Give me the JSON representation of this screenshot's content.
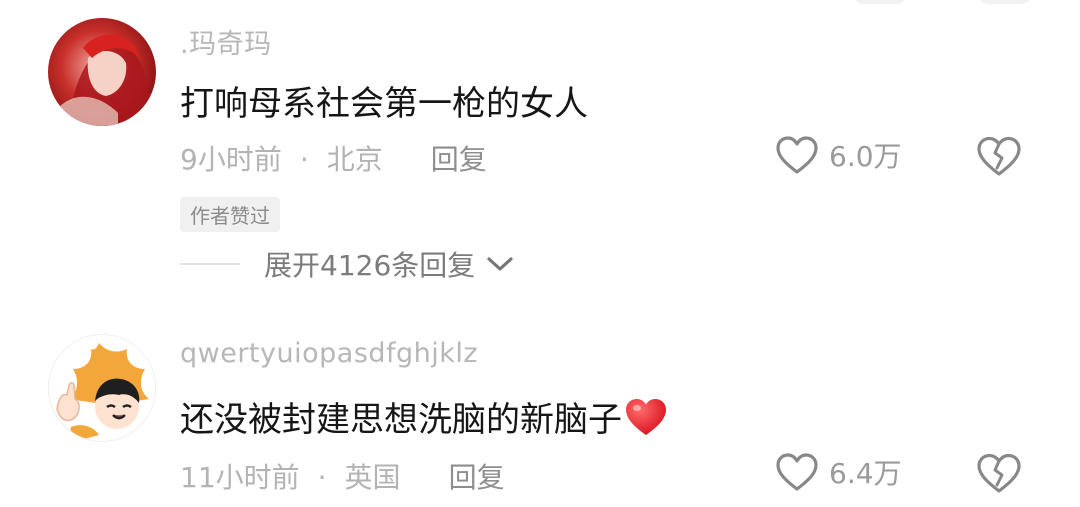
{
  "comments": [
    {
      "username": ".玛奇玛",
      "text": "打响母系社会第一枪的女人",
      "time": "9小时前",
      "separator": "·",
      "location": "北京",
      "reply_label": "回复",
      "like_count": "6.0万",
      "badge": "作者赞过",
      "expand_label": "展开4126条回复",
      "avatar_icon": "anime-avatar-red",
      "like_icon": "heart-outline-icon",
      "dislike_icon": "broken-heart-icon"
    },
    {
      "username": "qwertyuiopasdfghjklz",
      "text": "还没被封建思想洗脑的新脑子",
      "emoji": "red-heart-emoji",
      "time": "11小时前",
      "separator": "·",
      "location": "英国",
      "reply_label": "回复",
      "like_count": "6.4万",
      "avatar_icon": "cartoon-avatar",
      "like_icon": "heart-outline-icon",
      "dislike_icon": "broken-heart-icon"
    }
  ],
  "colors": {
    "text_primary": "#161616",
    "text_secondary": "#b3b3b3",
    "badge_bg": "#f0f0f0",
    "heart_red": "#e8232f"
  }
}
